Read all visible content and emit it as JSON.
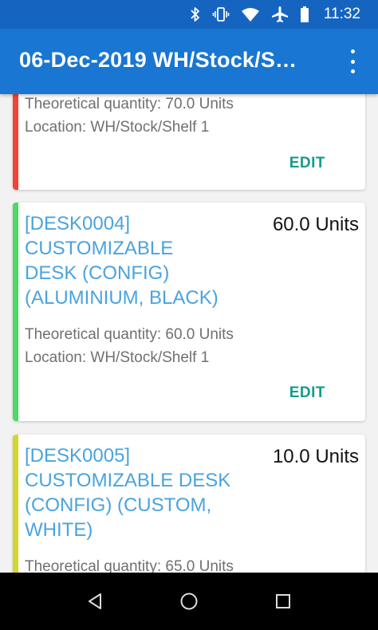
{
  "status_bar": {
    "time": "11:32",
    "icons": [
      "bluetooth-icon",
      "vibrate-icon",
      "wifi-icon",
      "airplane-icon",
      "battery-icon"
    ]
  },
  "app_bar": {
    "title": "06-Dec-2019  WH/Stock/S…",
    "menu_icon": "more-vert-icon"
  },
  "cards": [
    {
      "name": "",
      "quantity": "",
      "theoretical": "Theoretical quantity: 70.0 Units",
      "location": "Location: WH/Stock/Shelf 1",
      "edit": "EDIT",
      "accent": "#f44336"
    },
    {
      "name_lines": [
        "[DESK0004]",
        "CUSTOMIZABLE",
        "DESK (CONFIG)",
        "(ALUMINIUM, BLACK)"
      ],
      "quantity": "60.0 Units",
      "theoretical": "Theoretical quantity: 60.0 Units",
      "location": "Location: WH/Stock/Shelf 1",
      "edit": "EDIT",
      "accent": "#4cd964"
    },
    {
      "name_lines": [
        "[DESK0005]",
        "CUSTOMIZABLE DESK",
        "(CONFIG) (CUSTOM,",
        "WHITE)"
      ],
      "quantity": "10.0 Units",
      "theoretical": "Theoretical quantity: 65.0 Units",
      "accent": "#d4d62e"
    }
  ],
  "nav_bar": {
    "icons": [
      "back-icon",
      "home-icon",
      "recents-icon"
    ]
  },
  "colors": {
    "status_bar": "#1565c0",
    "app_bar": "#1976d2",
    "link": "#4aa3df",
    "edit": "#159b8a"
  }
}
